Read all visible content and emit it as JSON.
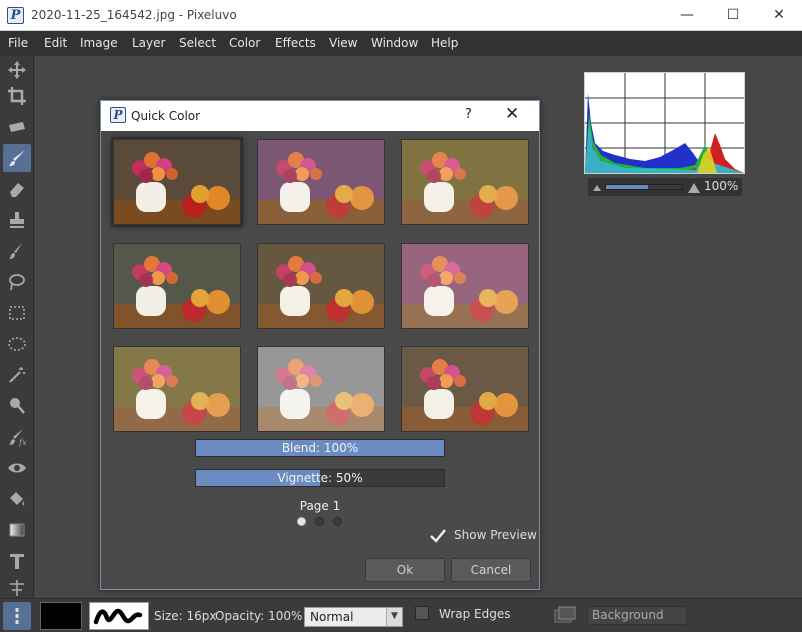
{
  "window": {
    "title": "2020-11-25_164542.jpg - Pixeluvo",
    "app_icon_letter": "P",
    "minimize_glyph": "—",
    "maximize_glyph": "☐",
    "close_glyph": "✕"
  },
  "menu": [
    "File",
    "Edit",
    "Image",
    "Layer",
    "Select",
    "Color",
    "Effects",
    "View",
    "Window",
    "Help"
  ],
  "histogram": {
    "zoom_label": "100%",
    "slider_value": 0.55
  },
  "dialog": {
    "title": "Quick Color",
    "icon_letter": "P",
    "help_glyph": "?",
    "close_glyph": "✕",
    "blend_label": "Blend: 100%",
    "blend_value": 1.0,
    "vignette_label": "Vignette: 50%",
    "vignette_value": 0.5,
    "page_label": "Page 1",
    "page_count": 3,
    "current_page": 1,
    "show_preview_label": "Show Preview",
    "show_preview_checked": true,
    "ok_label": "Ok",
    "cancel_label": "Cancel"
  },
  "options": {
    "size_label": "Size: 16px",
    "opacity_label": "Opacity: 100%",
    "blend_mode": "Normal",
    "wrap_edges_label": "Wrap Edges",
    "layer_field_value": "Background"
  },
  "colors": {
    "accent": "#6b8cc0",
    "primary_swatch": "#000000"
  },
  "icons": [
    "move-icon",
    "crop-icon",
    "gradient-icon",
    "brush-icon",
    "eraser-icon",
    "clone-stamp-icon",
    "heal-icon",
    "lasso-icon",
    "rect-select-icon",
    "ellipse-select-icon",
    "magic-wand-icon",
    "dodge-icon",
    "smudge-icon",
    "eye-icon",
    "fill-icon",
    "gradient-fill-icon",
    "text-icon",
    "transform-icon"
  ]
}
